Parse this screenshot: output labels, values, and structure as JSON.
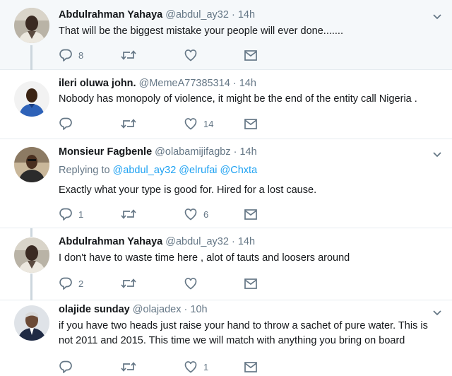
{
  "tweets": [
    {
      "name": "Abdulrahman Yahaya",
      "handle": "@abdul_ay32",
      "time": "· 14h",
      "text": "That will be the biggest mistake your people will ever done.......",
      "replies": "8",
      "retweets": "",
      "likes": ""
    },
    {
      "name": "ileri oluwa john.",
      "handle": "@MemeA77385314",
      "time": "· 14h",
      "text": "Nobody has monopoly of violence,  it might be the end of the entity call Nigeria .",
      "replies": "",
      "retweets": "",
      "likes": "14"
    },
    {
      "name": "Monsieur Fagbenle",
      "handle": "@olabamijifagbz",
      "time": "· 14h",
      "replying_label": "Replying to",
      "replying_mentions": "@abdul_ay32 @elrufai @Chxta",
      "text": "Exactly what your type is good for. Hired for a lost cause.",
      "replies": "1",
      "retweets": "",
      "likes": "6"
    },
    {
      "name": "Abdulrahman Yahaya",
      "handle": "@abdul_ay32",
      "time": "· 14h",
      "text": "I don't have to waste time here , alot of tauts and loosers around",
      "replies": "2",
      "retweets": "",
      "likes": ""
    },
    {
      "name": "olajide sunday",
      "handle": "@olajadex",
      "time": "· 10h",
      "text": "if you have two heads just raise your hand to throw a sachet of pure water. This is not 2011 and 2015. This time we will match with anything you bring on board",
      "replies": "",
      "retweets": "",
      "likes": "1"
    }
  ],
  "icons": {
    "reply": "reply-icon",
    "retweet": "retweet-icon",
    "like": "heart-icon",
    "dm": "envelope-icon",
    "more": "chevron-down-icon"
  },
  "colors": {
    "accent": "#1da1f2",
    "muted": "#657786",
    "highlight_bg": "#f5f8fa",
    "thread_line": "#ccd6dd"
  }
}
